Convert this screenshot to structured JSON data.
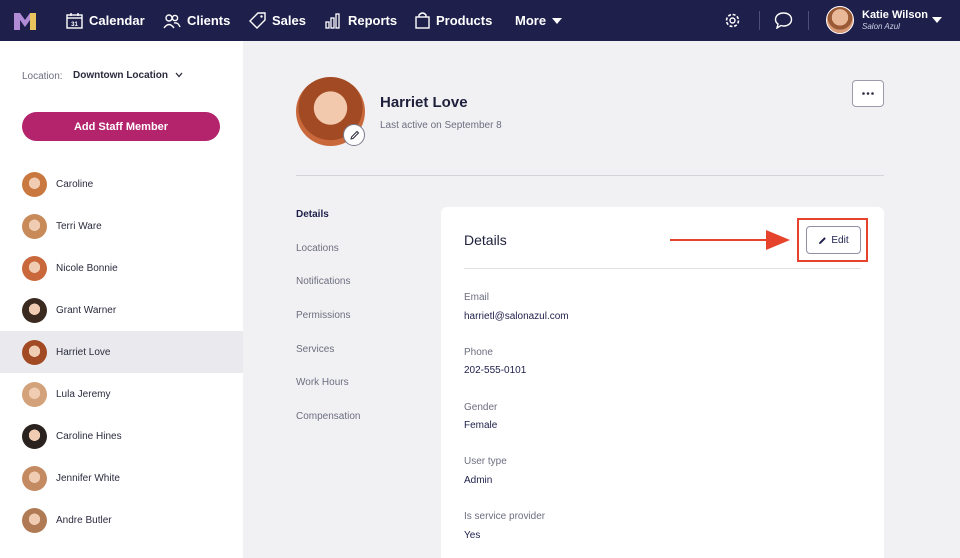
{
  "nav": {
    "items": [
      {
        "label": "Calendar",
        "icon": "calendar-icon"
      },
      {
        "label": "Clients",
        "icon": "clients-icon"
      },
      {
        "label": "Sales",
        "icon": "tag-icon"
      },
      {
        "label": "Reports",
        "icon": "bar-chart-icon"
      },
      {
        "label": "Products",
        "icon": "shopping-bag-icon"
      }
    ],
    "more_label": "More",
    "calendar_day": "31",
    "user_name": "Katie Wilson",
    "user_business": "Salon Azul"
  },
  "sidebar": {
    "location_label": "Location:",
    "location_value": "Downtown Location",
    "add_button": "Add Staff Member",
    "staff": [
      {
        "name": "Caroline",
        "color": "#c9783f",
        "active": false
      },
      {
        "name": "Terri Ware",
        "color": "#c98a5a",
        "active": false
      },
      {
        "name": "Nicole Bonnie",
        "color": "#c9683b",
        "active": false
      },
      {
        "name": "Grant Warner",
        "color": "#3a2a1f",
        "active": false
      },
      {
        "name": "Harriet Love",
        "color": "#a24a24",
        "active": true
      },
      {
        "name": "Lula Jeremy",
        "color": "#d3a27a",
        "active": false
      },
      {
        "name": "Caroline Hines",
        "color": "#2a221e",
        "active": false
      },
      {
        "name": "Jennifer White",
        "color": "#c48a62",
        "active": false
      },
      {
        "name": "Andre Butler",
        "color": "#b07a55",
        "active": false
      }
    ]
  },
  "profile": {
    "name": "Harriet Love",
    "last_active": "Last active on September 8"
  },
  "subnav": [
    "Details",
    "Locations",
    "Notifications",
    "Permissions",
    "Services",
    "Work Hours",
    "Compensation"
  ],
  "details": {
    "title": "Details",
    "edit_label": "Edit",
    "fields": [
      {
        "label": "Email",
        "value": "harrietl@salonazul.com"
      },
      {
        "label": "Phone",
        "value": "202-555-0101"
      },
      {
        "label": "Gender",
        "value": "Female"
      },
      {
        "label": "User type",
        "value": "Admin"
      },
      {
        "label": "Is service provider",
        "value": "Yes"
      }
    ]
  },
  "colors": {
    "nav_bg": "#1e1f4b",
    "accent": "#b3246d",
    "highlight": "#e5432b"
  }
}
